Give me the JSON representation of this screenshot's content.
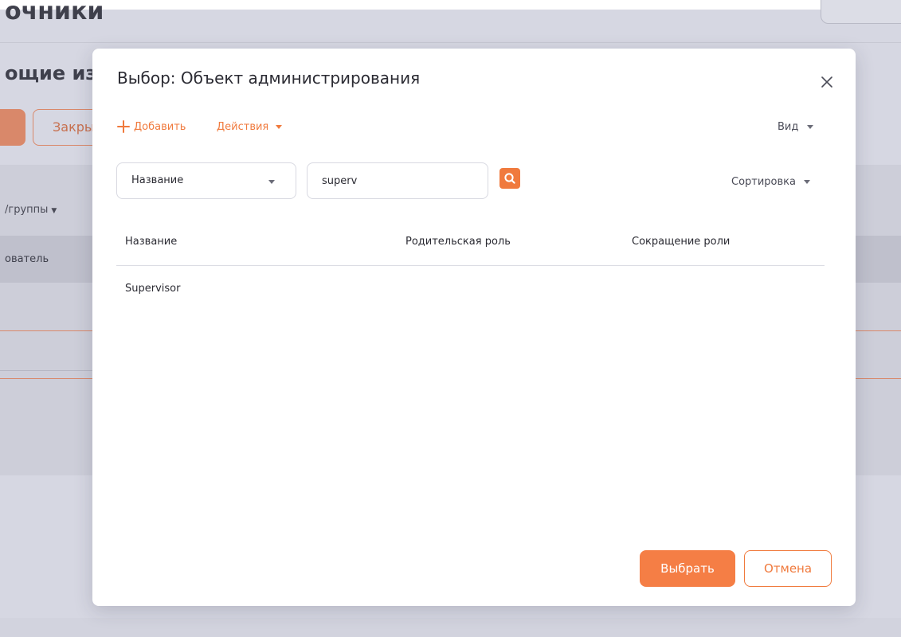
{
  "background": {
    "page_title": "очники",
    "section_title": "ощие изм",
    "close_button_label": "Закры",
    "groups_label": "/группы",
    "table_header_cell": "ователь"
  },
  "modal": {
    "title": "Выбор: Объект администрирования",
    "toolbar": {
      "add_label": "Добавить",
      "actions_label": "Действия",
      "view_label": "Вид"
    },
    "filter": {
      "field_selected": "Название",
      "search_value": "superv",
      "sort_label": "Сортировка"
    },
    "table": {
      "columns": [
        "Название",
        "Родительская роль",
        "Сокращение роли"
      ],
      "rows": [
        [
          "Supervisor",
          "",
          ""
        ]
      ]
    },
    "footer": {
      "select_label": "Выбрать",
      "cancel_label": "Отмена"
    },
    "colors": {
      "accent": "#f07a3d",
      "primary_button": "#f57e45",
      "overlay_background": "#d6d7e2"
    },
    "icons": {
      "close": "close-icon",
      "add": "plus-icon",
      "search": "search-icon",
      "dropdown": "chevron-down-icon"
    }
  }
}
